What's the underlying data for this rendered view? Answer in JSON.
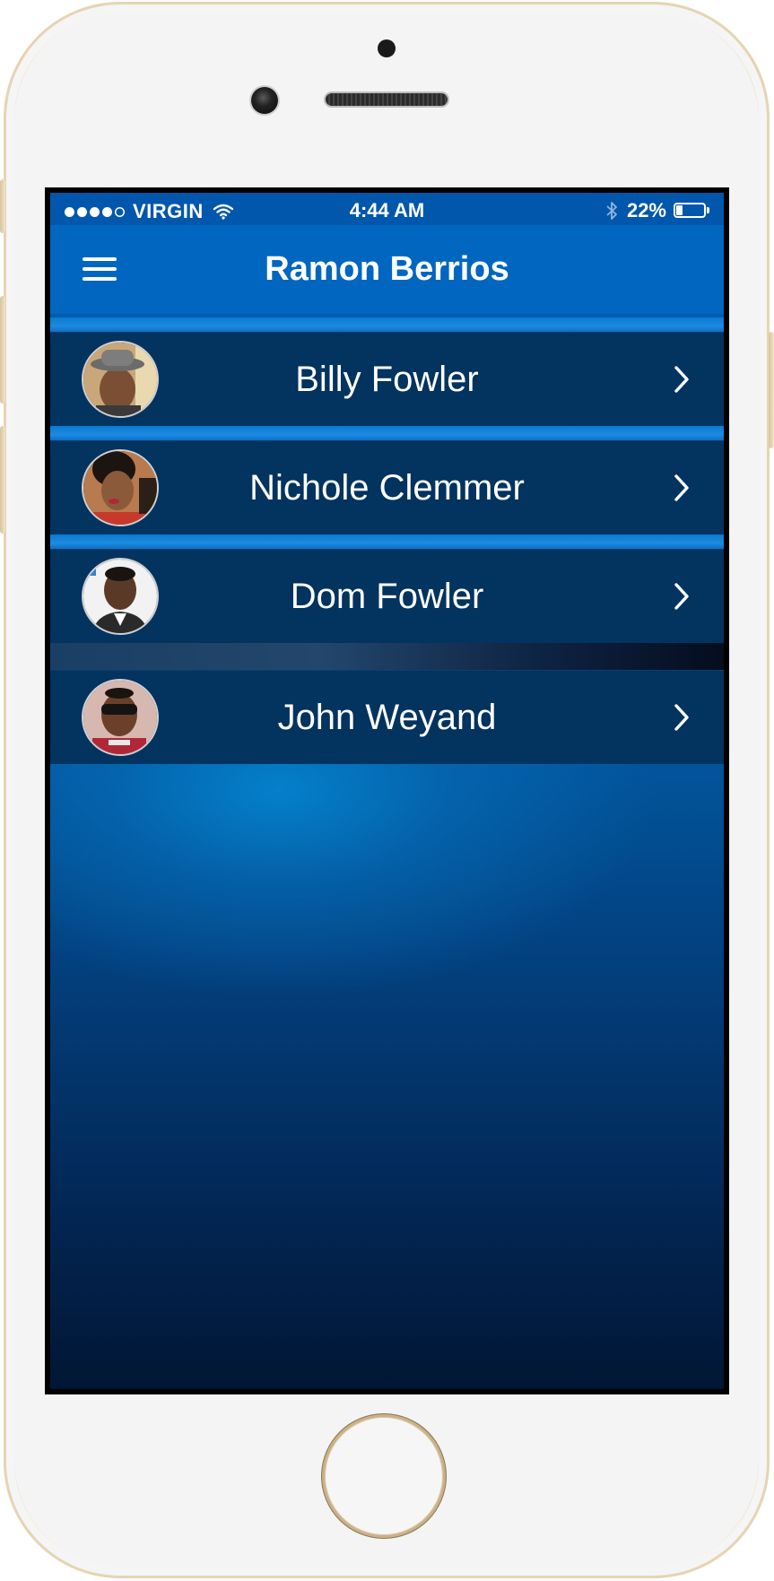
{
  "status_bar": {
    "carrier": "VIRGIN",
    "time": "4:44 AM",
    "battery": "22%",
    "battery_level": 0.22,
    "signal_bars_filled": 4,
    "signal_bars_total": 5
  },
  "nav": {
    "title": "Ramon Berrios",
    "menu_icon": "hamburger-menu-icon"
  },
  "contacts": [
    {
      "name": "Billy Fowler",
      "icon": "chevron-right-icon"
    },
    {
      "name": "Nichole Clemmer",
      "icon": "chevron-right-icon"
    },
    {
      "name": "Dom Fowler",
      "icon": "chevron-right-icon"
    },
    {
      "name": "John Weyand",
      "icon": "chevron-right-icon"
    }
  ],
  "colors": {
    "nav_background": "#0066c0",
    "row_background": "#03335f",
    "text": "#ffffff",
    "phone_frame": "#f6ecd9"
  }
}
